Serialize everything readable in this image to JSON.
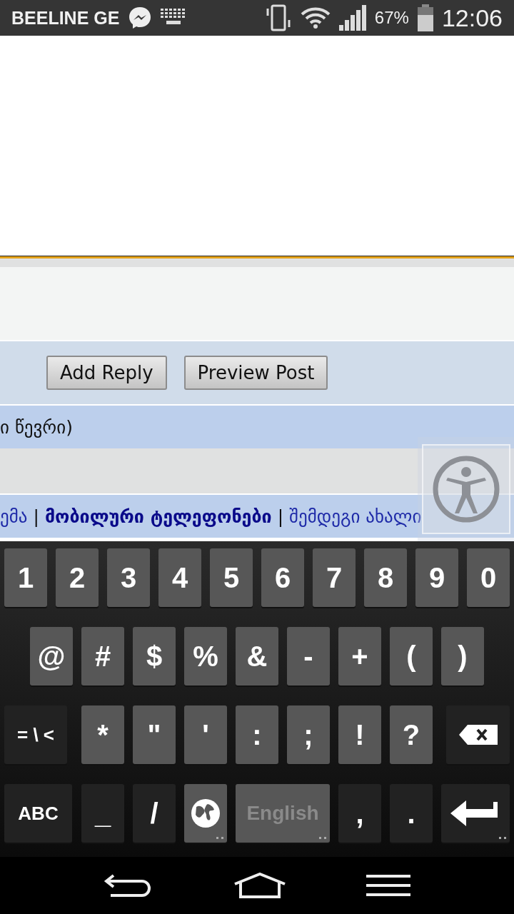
{
  "status_bar": {
    "carrier": "BEELINE GE",
    "battery": "67%",
    "time": "12:06"
  },
  "form": {
    "buttons": [
      "Add Reply",
      "Preview Post"
    ]
  },
  "members_row": {
    "text": "ი წევრი)"
  },
  "breadcrumb": [
    {
      "text": "ემა",
      "kind": "text"
    },
    {
      "text": "|",
      "kind": "separator"
    },
    {
      "text": "მობილური ტელეფონები",
      "kind": "link",
      "bold": true
    },
    {
      "text": "|",
      "kind": "separator"
    },
    {
      "text": "შემდეგი ახალი",
      "kind": "link",
      "bold": false
    }
  ],
  "keyboard": {
    "rows": [
      {
        "keys": [
          {
            "label": "1",
            "kind": "char"
          },
          {
            "label": "2",
            "kind": "char"
          },
          {
            "label": "3",
            "kind": "char"
          },
          {
            "label": "4",
            "kind": "char"
          },
          {
            "label": "5",
            "kind": "char"
          },
          {
            "label": "6",
            "kind": "char"
          },
          {
            "label": "7",
            "kind": "char"
          },
          {
            "label": "8",
            "kind": "char"
          },
          {
            "label": "9",
            "kind": "char"
          },
          {
            "label": "0",
            "kind": "char"
          }
        ]
      },
      {
        "keys": [
          {
            "label": "@",
            "kind": "char"
          },
          {
            "label": "#",
            "kind": "char"
          },
          {
            "label": "$",
            "kind": "char"
          },
          {
            "label": "%",
            "kind": "char"
          },
          {
            "label": "&",
            "kind": "char"
          },
          {
            "label": "-",
            "kind": "char"
          },
          {
            "label": "+",
            "kind": "char"
          },
          {
            "label": "(",
            "kind": "char"
          },
          {
            "label": ")",
            "kind": "char"
          }
        ]
      },
      {
        "keys": [
          {
            "label": "= \\ <",
            "kind": "mode"
          },
          {
            "label": "*",
            "kind": "char"
          },
          {
            "label": "\"",
            "kind": "char"
          },
          {
            "label": "'",
            "kind": "char"
          },
          {
            "label": ":",
            "kind": "char"
          },
          {
            "label": ";",
            "kind": "char"
          },
          {
            "label": "!",
            "kind": "char"
          },
          {
            "label": "?",
            "kind": "char"
          },
          {
            "kind": "backspace"
          }
        ]
      },
      {
        "keys": [
          {
            "label": "ABC",
            "kind": "mode"
          },
          {
            "label": "_",
            "kind": "symbol"
          },
          {
            "label": "/",
            "kind": "symbol"
          },
          {
            "kind": "globe"
          },
          {
            "label": "English",
            "kind": "space"
          },
          {
            "label": ",",
            "kind": "symbol"
          },
          {
            "label": ".",
            "kind": "symbol"
          },
          {
            "kind": "enter"
          }
        ]
      }
    ]
  }
}
